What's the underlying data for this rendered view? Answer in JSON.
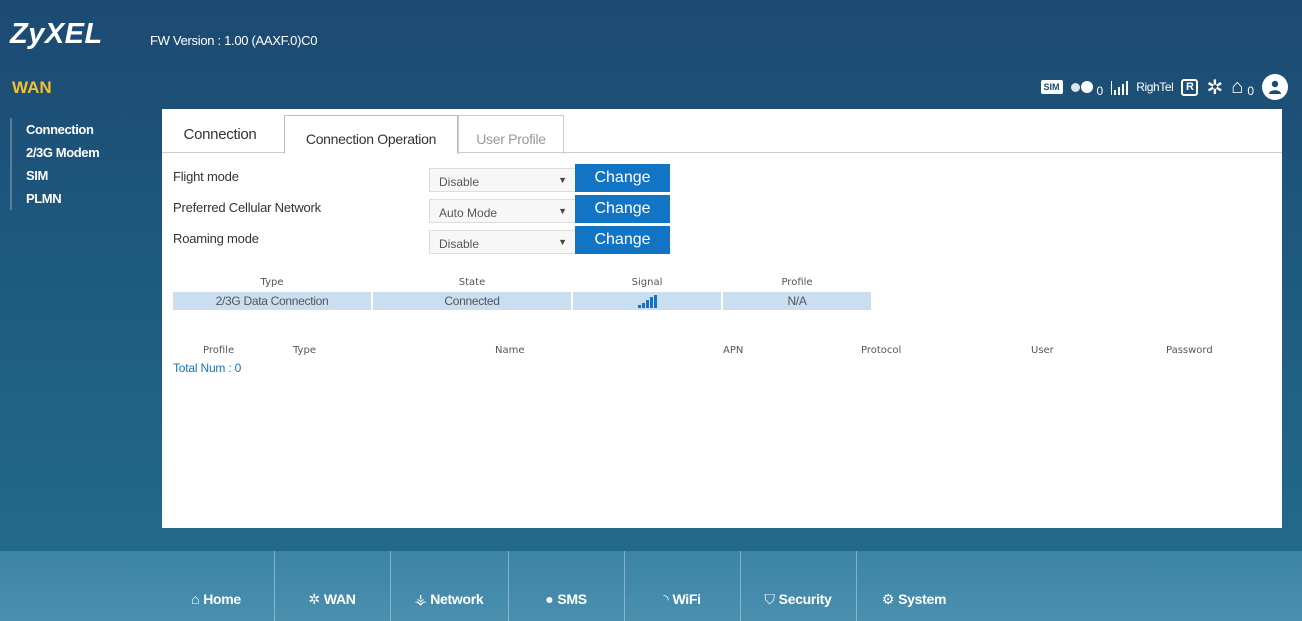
{
  "brand": {
    "logo": "ZyXEL",
    "fw_version": "FW Version : 1.00 (AAXF.0)C0"
  },
  "section_title": "WAN",
  "status": {
    "sim_label": "SIM",
    "sms_count": "0",
    "operator": "RighTel",
    "roaming_label": "R",
    "router_count": "0",
    "icons": [
      "sim-icon",
      "sms-icon",
      "signal-icon",
      "roaming-icon",
      "globe-icon",
      "router-icon",
      "user-icon"
    ]
  },
  "sidebar": {
    "items": [
      {
        "label": "Connection"
      },
      {
        "label": "2/3G Modem"
      },
      {
        "label": "SIM"
      },
      {
        "label": "PLMN"
      }
    ]
  },
  "tabs": [
    {
      "label": "Connection"
    },
    {
      "label": "Connection Operation"
    },
    {
      "label": "User Profile"
    }
  ],
  "form": {
    "rows": [
      {
        "label": "Flight mode",
        "value": "Disable",
        "button": "Change"
      },
      {
        "label": "Preferred Cellular Network",
        "value": "Auto Mode",
        "button": "Change"
      },
      {
        "label": "Roaming mode",
        "value": "Disable",
        "button": "Change"
      }
    ]
  },
  "conn_table": {
    "headers": [
      "Type",
      "State",
      "Signal",
      "Profile"
    ],
    "row": {
      "type": "2/3G Data Connection",
      "state": "Connected",
      "signal_level": 5,
      "profile": "N/A"
    }
  },
  "profile_table": {
    "headers": [
      "Profile",
      "Type",
      "Name",
      "APN",
      "Protocol",
      "User",
      "Password"
    ],
    "total": "Total Num : 0"
  },
  "bottom_nav": {
    "items": [
      {
        "label": "Home",
        "icon": "home-icon"
      },
      {
        "label": "WAN",
        "icon": "globe-icon"
      },
      {
        "label": "Network",
        "icon": "network-icon"
      },
      {
        "label": "SMS",
        "icon": "sms-icon"
      },
      {
        "label": "WiFi",
        "icon": "wifi-icon"
      },
      {
        "label": "Security",
        "icon": "shield-icon"
      },
      {
        "label": "System",
        "icon": "system-icon"
      }
    ]
  },
  "colors": {
    "accent": "#1274c4",
    "title": "#f5c12e",
    "row_bg": "#c9dff1"
  }
}
